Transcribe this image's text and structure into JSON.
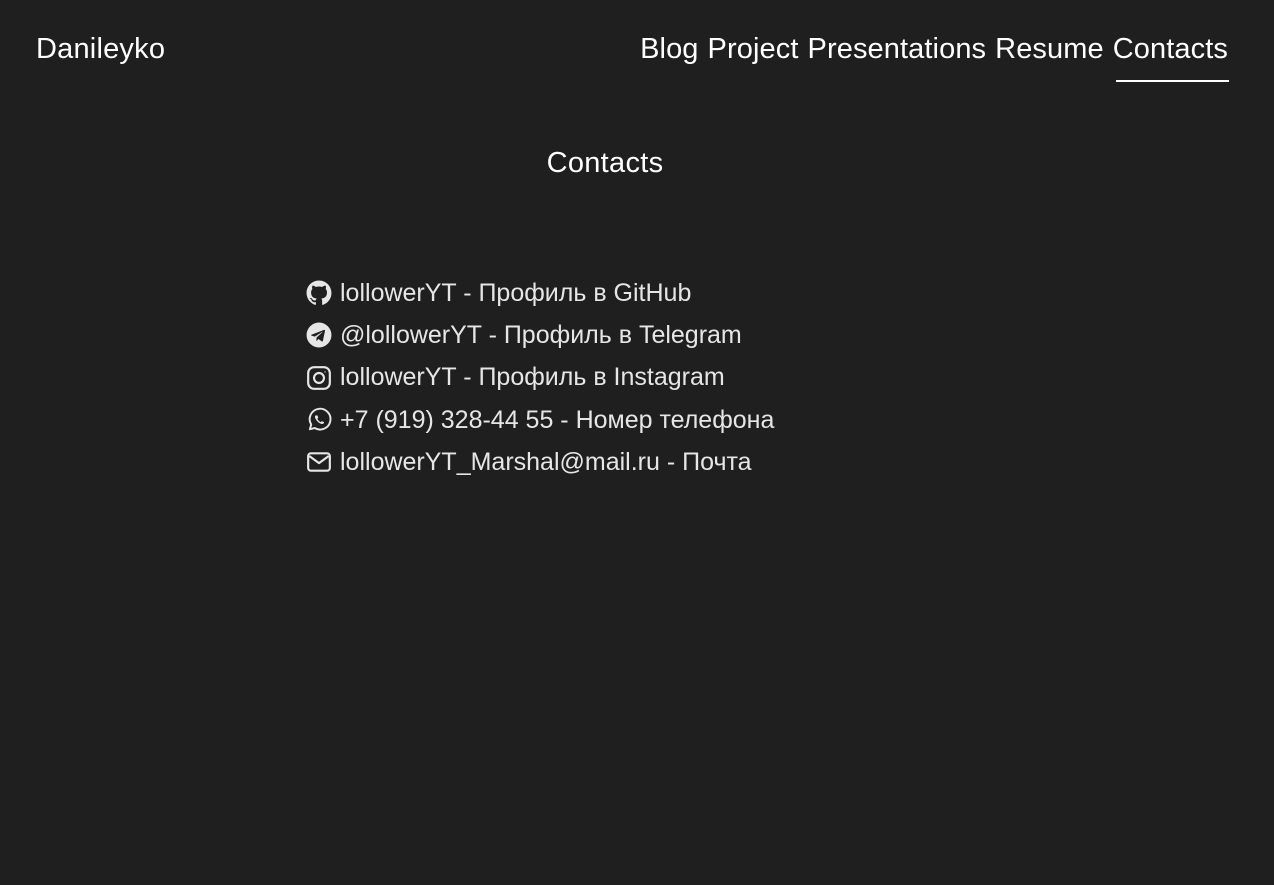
{
  "header": {
    "brand": "Danileyko",
    "nav": [
      {
        "label": "Blog"
      },
      {
        "label": "Project"
      },
      {
        "label": "Presentations"
      },
      {
        "label": "Resume"
      },
      {
        "label": "Contacts",
        "active": true
      }
    ]
  },
  "main": {
    "title": "Contacts",
    "contacts": [
      {
        "icon": "github-icon",
        "text": "lollowerYT - Профиль в GitHub"
      },
      {
        "icon": "telegram-icon",
        "text": "@lollowerYT - Профиль в Telegram"
      },
      {
        "icon": "instagram-icon",
        "text": "lollowerYT - Профиль в Instagram"
      },
      {
        "icon": "whatsapp-icon",
        "text": "+7 (919) 328-44 55 - Номер телефона"
      },
      {
        "icon": "mail-icon",
        "text": "lollowerYT_Marshal@mail.ru - Почта"
      }
    ]
  },
  "colors": {
    "background": "#1f1f1f",
    "text": "#ffffff",
    "contact_text": "#e6e6e6"
  }
}
